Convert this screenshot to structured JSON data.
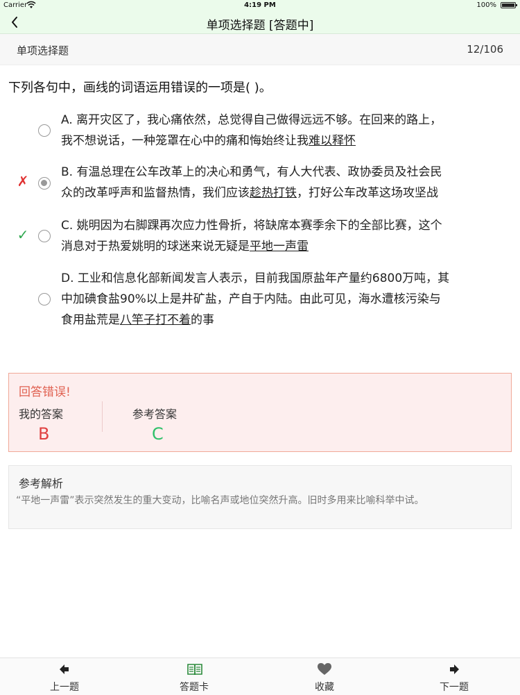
{
  "status_bar": {
    "carrier": "Carrier",
    "time": "4:19 PM",
    "battery": "100%"
  },
  "nav": {
    "title": "单项选择题 [答题中]"
  },
  "sub_header": {
    "type": "单项选择题",
    "counter": "12/106"
  },
  "question": {
    "text": "下列各句中，画线的词语运用错误的一项是( )。"
  },
  "options": [
    {
      "line1": "A. 离开灾区了，我心痛依然，总觉得自己做得远远不够。在回来的路上，",
      "line2_pre": "我不想说话，一种笼罩在心中的痛和悔始终让我",
      "underline": "难以释怀",
      "line2_post": "",
      "mark": "",
      "selected": false
    },
    {
      "line1": "B. 有温总理在公车改革上的决心和勇气，有人大代表、政协委员及社会民",
      "line2_pre": "众的改革呼声和监督热情，我们应该",
      "underline": "趁热打铁",
      "line2_post": "，打好公车改革这场攻坚战",
      "mark": "✗",
      "selected": true
    },
    {
      "line1": "C. 姚明因为右脚踝再次应力性骨折，将缺席本赛季余下的全部比赛，这个",
      "line2_pre": "消息对于热爱姚明的球迷来说无疑是",
      "underline": "平地一声雷",
      "line2_post": "",
      "mark": "✓",
      "selected": false
    },
    {
      "line1": "D. 工业和信息化部新闻发言人表示，目前我国原盐年产量约6800万吨，其",
      "line2": "中加碘食盐90%以上是井矿盐，产自于内陆。由此可见，海水遭核污染与",
      "line3_pre": "食用盐荒是",
      "underline": "八竿子打不着",
      "line3_post": "的事",
      "mark": "",
      "selected": false
    }
  ],
  "result": {
    "status": "回答错误!",
    "my_label": "我的答案",
    "my_answer": "B",
    "ref_label": "参考答案",
    "ref_answer": "C"
  },
  "analysis": {
    "heading": "参考解析",
    "body": "“平地一声雷”表示突然发生的重大变动，比喻名声或地位突然升高。旧时多用来比喻科举中试。"
  },
  "tabs": [
    {
      "label": "上一题",
      "icon": "arrow-left-icon"
    },
    {
      "label": "答题卡",
      "icon": "book-icon"
    },
    {
      "label": "收藏",
      "icon": "heart-icon"
    },
    {
      "label": "下一题",
      "icon": "arrow-right-icon"
    }
  ],
  "colors": {
    "nav_bg": "#ebfbeb",
    "wrong": "#e03030",
    "right": "#2fa84f",
    "answer_right": "#2fc06a",
    "tab_accent": "#2a8a3a"
  }
}
